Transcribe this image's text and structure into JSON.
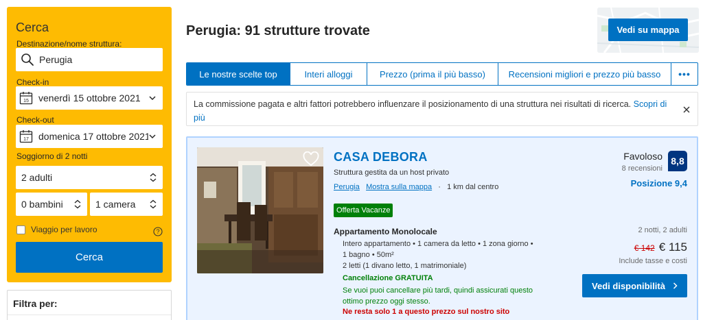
{
  "sidebar": {
    "title": "Cerca",
    "destination": {
      "label": "Destinazione/nome struttura:",
      "value": "Perugia"
    },
    "checkin": {
      "label": "Check-in",
      "value": "venerdì 15 ottobre 2021",
      "icon_day": "15"
    },
    "checkout": {
      "label": "Check-out",
      "value": "domenica 17 ottobre 2021",
      "icon_day": "17"
    },
    "stay_length": "Soggiorno di 2 notti",
    "adults": "2 adulti",
    "children": "0 bambini",
    "rooms": "1 camera",
    "work_trip_label": "Viaggio per lavoro",
    "search_button": "Cerca",
    "filter_title": "Filtra per:"
  },
  "header": {
    "title": "Perugia: 91 strutture trovate",
    "map_button": "Vedi su mappa"
  },
  "tabs": [
    {
      "label": "Le nostre scelte top",
      "active": true
    },
    {
      "label": "Interi alloggi",
      "active": false
    },
    {
      "label": "Prezzo (prima il più basso)",
      "active": false
    },
    {
      "label": "Recensioni migliori e prezzo più basso",
      "active": false
    },
    {
      "label": "•••",
      "active": false
    }
  ],
  "notice": {
    "text": "La commissione pagata e altri fattori potrebbero influenzare il posizionamento di una struttura nei risultati di ricerca. ",
    "link": "Scopri di più"
  },
  "property": {
    "name": "CASA DEBORA",
    "host": "Struttura gestita da un host privato",
    "city_link": "Perugia",
    "map_link": "Mostra sulla mappa",
    "distance": "1 km dal centro",
    "badge": "Offerta Vacanze",
    "room_title": "Appartamento Monolocale",
    "room_line1": "Intero appartamento • 1 camera da letto • 1 zona giorno •",
    "room_line2": "1 bagno • 50m²",
    "beds": "2 letti (1 divano letto, 1 matrimoniale)",
    "cancellation_title": "Cancellazione GRATUITA",
    "cancellation_text": "Se vuoi puoi cancellare più tardi, quindi assicurati questo ottimo prezzo oggi stesso.",
    "scarcity": "Ne resta solo 1 a questo prezzo sul nostro sito",
    "rating_word": "Favoloso",
    "review_count": "8 recensioni",
    "score": "8,8",
    "location_score": "Posizione 9,4",
    "stay_info": "2 notti, 2 adulti",
    "old_price": "€ 142",
    "price": "€ 115",
    "tax_note": "Include tasse e costi",
    "availability_button": "Vedi disponibilità"
  },
  "colors": {
    "brand_blue": "#0071c2",
    "search_yellow": "#febb02",
    "score_navy": "#003580",
    "green": "#008009",
    "red": "#cc0000",
    "card_bg": "#ebf3ff"
  }
}
